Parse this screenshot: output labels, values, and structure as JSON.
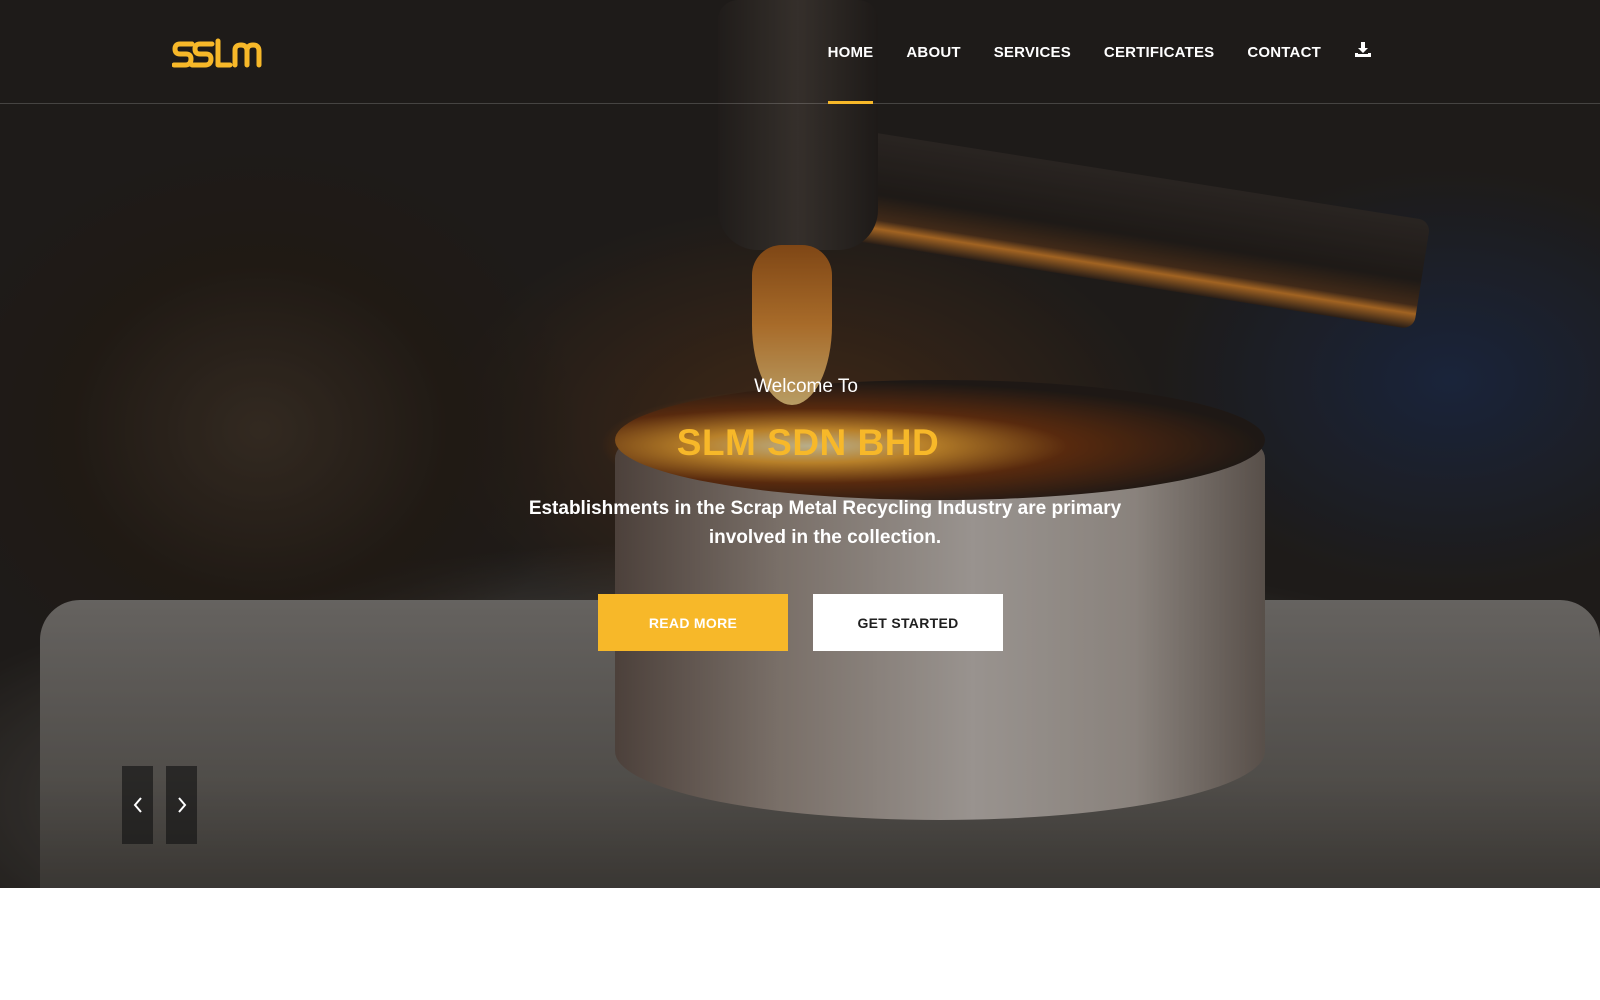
{
  "brand": {
    "logo_text": "SSLM",
    "accent_color": "#f7b829"
  },
  "nav": {
    "items": [
      {
        "label": "HOME",
        "active": true
      },
      {
        "label": "ABOUT",
        "active": false
      },
      {
        "label": "SERVICES",
        "active": false
      },
      {
        "label": "CERTIFICATES",
        "active": false
      },
      {
        "label": "CONTACT",
        "active": false
      }
    ],
    "download_icon": "download-icon"
  },
  "hero": {
    "welcome": "Welcome To",
    "title": "SLM SDN BHD",
    "description": "Establishments in the Scrap Metal Recycling Industry are primary involved in the collection.",
    "read_more": "READ MORE",
    "get_started": "GET STARTED",
    "prev_icon": "chevron-left-icon",
    "next_icon": "chevron-right-icon"
  }
}
